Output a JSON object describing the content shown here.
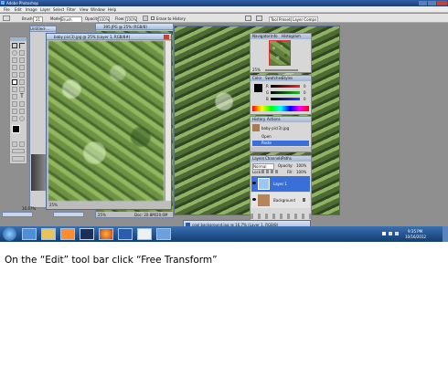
{
  "app": {
    "window_title": "Adobe Photoshop",
    "menu": [
      "File",
      "Edit",
      "Image",
      "Layer",
      "Select",
      "Filter",
      "View",
      "Window",
      "Help"
    ],
    "options_bar": {
      "brush_label": "Brush:",
      "brush_value": "21",
      "mode_label": "Mode:",
      "mode_value": "Brush",
      "opacity_label": "Opacity:",
      "opacity_value": "100%",
      "flow_label": "Flow:",
      "flow_value": "100%",
      "erase_history_label": "Erase to History",
      "tool_presets_label": "Tool Presets",
      "layer_comps_label": "Layer Comps"
    }
  },
  "documents": {
    "background_doc_title": "Untitled-...",
    "main_doc_title": "baby pic(3).jpg @ 25% (Layer 1, RGB/8#)",
    "main_doc_zoom": "25%",
    "mid_doc_title": "395.JPG @ 25% (RGB/8)",
    "mid_doc_zoom": "25%",
    "mid_doc_status": "Doc: 20.8M/20.6M",
    "front_doc_title": "cool background.jpg @ 16.7% (Layer 1, RGB/8)",
    "left_zoom": "16.67%"
  },
  "panels": {
    "navigator": {
      "tabs": [
        "Navigator",
        "Info",
        "Histogram"
      ],
      "zoom": "25%"
    },
    "color": {
      "tabs": [
        "Color",
        "Swatches",
        "Styles"
      ],
      "channels": [
        {
          "label": "R",
          "value": "0",
          "color": "#ff2020"
        },
        {
          "label": "G",
          "value": "0",
          "color": "#20c020"
        },
        {
          "label": "B",
          "value": "0",
          "color": "#2040ff"
        }
      ]
    },
    "history": {
      "tabs": [
        "History",
        "Actions"
      ],
      "snapshot": "baby pic(3).jpg",
      "items": [
        "Open",
        "Paste"
      ]
    },
    "layers": {
      "tabs": [
        "Layers",
        "Channels",
        "Paths"
      ],
      "blend_mode": "Normal",
      "opacity_label": "Opacity:",
      "opacity_value": "100%",
      "lock_label": "Lock:",
      "fill_label": "Fill:",
      "fill_value": "100%",
      "layers": [
        {
          "name": "Layer 1",
          "selected": true
        },
        {
          "name": "Background",
          "selected": false
        }
      ]
    }
  },
  "taskbar": {
    "time": "9:35 PM",
    "date": "10/16/2012",
    "apps": [
      "ie-icon",
      "folder-icon",
      "media-icon",
      "photoshop-icon",
      "firefox-icon",
      "word-icon",
      "paint-icon",
      "ps-file-icon"
    ]
  },
  "caption": "On the “Edit” tool bar click “Free Transform”"
}
